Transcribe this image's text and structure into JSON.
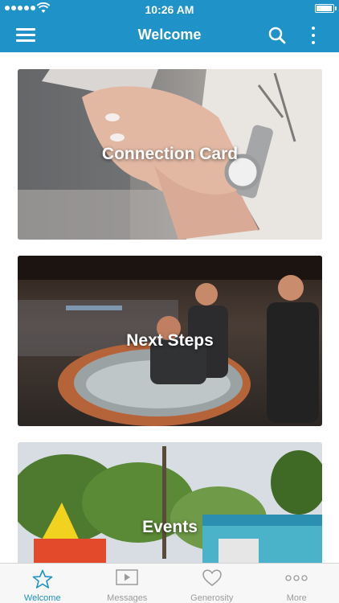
{
  "status_bar": {
    "time": "10:26 AM"
  },
  "nav": {
    "title": "Welcome",
    "menu_icon": "hamburger-menu-icon",
    "search_icon": "search-icon",
    "more_icon": "vertical-dots-icon"
  },
  "cards": [
    {
      "label": "Connection Card"
    },
    {
      "label": "Next Steps"
    },
    {
      "label": "Events"
    }
  ],
  "tab_bar": {
    "tabs": [
      {
        "label": "Welcome",
        "icon": "star-icon",
        "active": true
      },
      {
        "label": "Messages",
        "icon": "video-play-icon",
        "active": false
      },
      {
        "label": "Generosity",
        "icon": "heart-icon",
        "active": false
      },
      {
        "label": "More",
        "icon": "horizontal-dots-icon",
        "active": false
      }
    ]
  },
  "colors": {
    "brand": "#1f93c8",
    "tab_inactive": "#9b9b9b"
  }
}
